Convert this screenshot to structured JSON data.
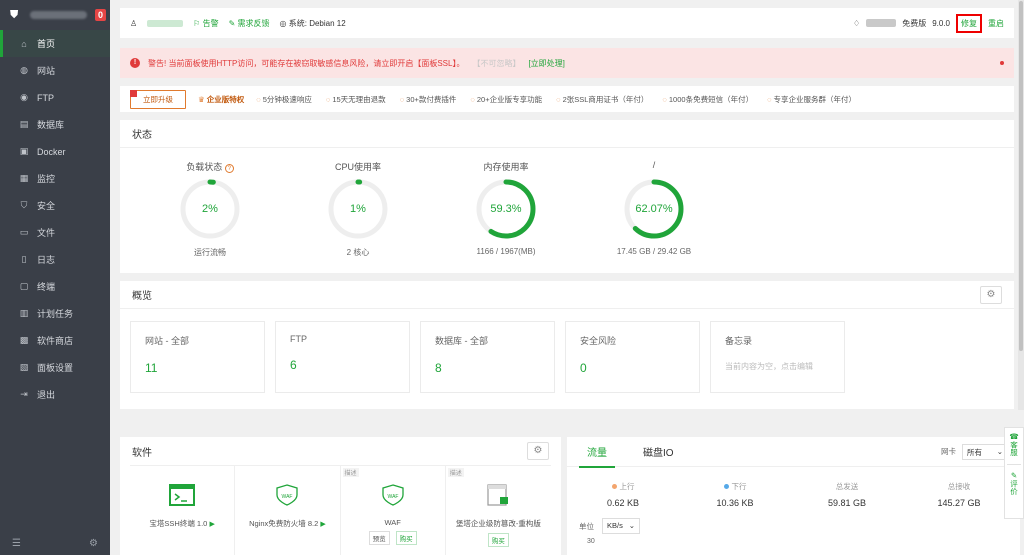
{
  "sidebar": {
    "badge": "0",
    "items": [
      {
        "label": "首页",
        "icon": "home-icon",
        "glyph": "⌂"
      },
      {
        "label": "网站",
        "icon": "globe-icon",
        "glyph": "◍"
      },
      {
        "label": "FTP",
        "icon": "ftp-icon",
        "glyph": "◉"
      },
      {
        "label": "数据库",
        "icon": "database-icon",
        "glyph": "▤"
      },
      {
        "label": "Docker",
        "icon": "docker-icon",
        "glyph": "▣"
      },
      {
        "label": "监控",
        "icon": "monitor-icon",
        "glyph": "▦"
      },
      {
        "label": "安全",
        "icon": "shield-icon",
        "glyph": "⛉"
      },
      {
        "label": "文件",
        "icon": "folder-icon",
        "glyph": "▭"
      },
      {
        "label": "日志",
        "icon": "log-icon",
        "glyph": "▯"
      },
      {
        "label": "终端",
        "icon": "terminal-icon",
        "glyph": "▢"
      },
      {
        "label": "计划任务",
        "icon": "task-icon",
        "glyph": "▥"
      },
      {
        "label": "软件商店",
        "icon": "store-icon",
        "glyph": "▩"
      },
      {
        "label": "面板设置",
        "icon": "settings-icon",
        "glyph": "▧"
      },
      {
        "label": "退出",
        "icon": "logout-icon",
        "glyph": "⇥"
      }
    ]
  },
  "topbar": {
    "alert": "告警",
    "feedback": "需求反馈",
    "system": "系统:",
    "os": "Debian 12",
    "edition": "免费版",
    "version": "9.0.0",
    "repair": "修复",
    "restart": "重启"
  },
  "warning": {
    "text": "警告! 当前面板使用HTTP访问，可能存在被窃取敏感信息风险，请立即开启【面板SSL】。",
    "ignore": "【不可忽略】",
    "fix": "[立即处理]"
  },
  "promo": {
    "upgrade": "立即升级",
    "enterprise": "企业版特权",
    "items": [
      "5分钟极速响应",
      "15天无理由退款",
      "30+款付费插件",
      "20+企业版专享功能",
      "2张SSL商用证书（年付）",
      "1000条免费短信（年付）",
      "专享企业服务群（年付）"
    ]
  },
  "status": {
    "title": "状态",
    "gauges": [
      {
        "label": "负载状态",
        "value": "2%",
        "percent": 2,
        "sub": "运行流畅",
        "help": "?"
      },
      {
        "label": "CPU使用率",
        "value": "1%",
        "percent": 1,
        "sub": "2 核心"
      },
      {
        "label": "内存使用率",
        "value": "59.3%",
        "percent": 59.3,
        "sub": "1166 / 1967(MB)"
      },
      {
        "label": "/",
        "value": "62.07%",
        "percent": 62.07,
        "sub": "17.45 GB / 29.42 GB"
      }
    ]
  },
  "overview": {
    "title": "概览",
    "cards": [
      {
        "title": "网站 - 全部",
        "value": "11"
      },
      {
        "title": "FTP",
        "value": "6"
      },
      {
        "title": "数据库 - 全部",
        "value": "8"
      },
      {
        "title": "安全风险",
        "value": "0"
      },
      {
        "title": "备忘录",
        "note": "当前内容为空，点击编辑"
      }
    ]
  },
  "software": {
    "title": "软件",
    "items": [
      {
        "name": "宝塔SSH终端 1.0",
        "play": "▶"
      },
      {
        "name": "Nginx免费防火墙 8.2",
        "play": "▶"
      },
      {
        "name": "WAF",
        "tag": "描述",
        "preview": "预览",
        "buy": "购买"
      },
      {
        "name": "堡塔企业级防篡改-重构版",
        "tag": "描述",
        "buy": "购买"
      }
    ]
  },
  "traffic": {
    "tab_flow": "流量",
    "tab_disk": "磁盘IO",
    "nic_label": "网卡",
    "nic_value": "所有",
    "stats": [
      {
        "label": "上行",
        "value": "0.62 KB",
        "dot": "orange"
      },
      {
        "label": "下行",
        "value": "10.36 KB",
        "dot": "blue"
      },
      {
        "label": "总发送",
        "value": "59.81 GB"
      },
      {
        "label": "总接收",
        "value": "145.27 GB"
      }
    ],
    "unit_label": "单位",
    "unit_value": "KB/s",
    "y_tick": "30"
  },
  "float": {
    "service": "客服",
    "review": "评价"
  },
  "colors": {
    "accent": "#20a53a",
    "danger": "#e03a3a",
    "sidebar": "#3a3f48"
  }
}
